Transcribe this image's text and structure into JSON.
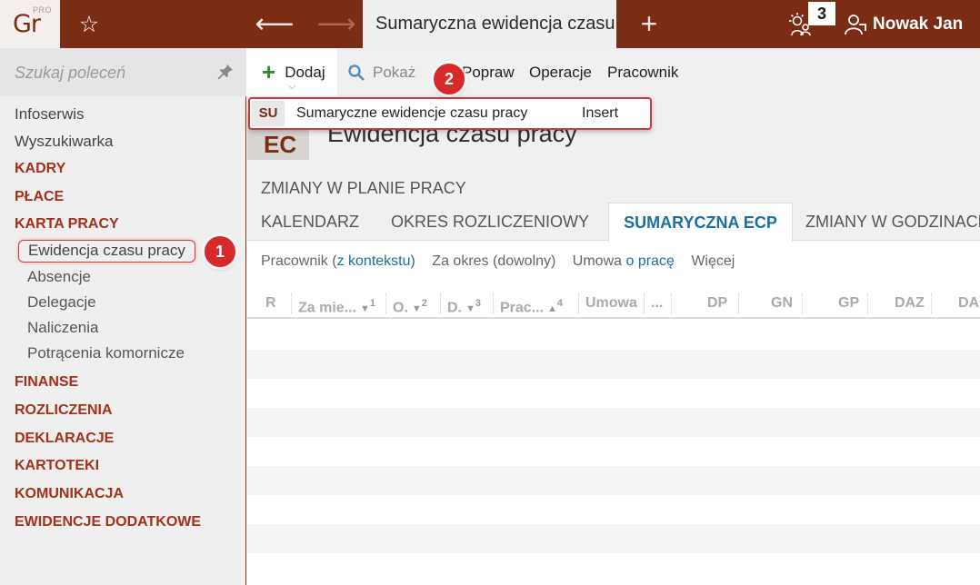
{
  "app": {
    "logo_text": "Gr",
    "logo_badge": "PRO",
    "active_tab": "Sumaryczna ewidencja czasu pracy",
    "notifications_count": "3",
    "user_name": "Nowak Jan"
  },
  "sidebar": {
    "search_placeholder": "Szukaj poleceń",
    "items": [
      {
        "label": "Infoserwis"
      },
      {
        "label": "Wyszukiwarka"
      },
      {
        "label": "KADRY"
      },
      {
        "label": "PŁACE"
      },
      {
        "label": "KARTA PRACY"
      },
      {
        "label": "Ewidencja czasu pracy"
      },
      {
        "label": "Absencje"
      },
      {
        "label": "Delegacje"
      },
      {
        "label": "Naliczenia"
      },
      {
        "label": "Potrącenia komornicze"
      },
      {
        "label": "FINANSE"
      },
      {
        "label": "ROZLICZENIA"
      },
      {
        "label": "DEKLARACJE"
      },
      {
        "label": "KARTOTEKI"
      },
      {
        "label": "KOMUNIKACJA"
      },
      {
        "label": "EWIDENCJE DODATKOWE"
      }
    ]
  },
  "toolbar": {
    "dodaj": "Dodaj",
    "pokaz": "Pokaż",
    "popraw": "Popraw",
    "operacje": "Operacje",
    "pracownik": "Pracownik"
  },
  "dropdown": {
    "code": "SU",
    "label": "Sumaryczne ewidencje czasu pracy",
    "shortcut": "Insert"
  },
  "page": {
    "badge": "EC",
    "title": "Ewidencja czasu pracy",
    "section": "ZMIANY W PLANIE PRACY"
  },
  "tabs": [
    {
      "label": "KALENDARZ"
    },
    {
      "label": "OKRES ROZLICZENIOWY"
    },
    {
      "label": "SUMARYCZNA ECP"
    },
    {
      "label": "ZMIANY W GODZINACH"
    }
  ],
  "filters": {
    "pracownik_prefix": "Pracownik (",
    "pracownik_link": "z kontekstu",
    "pracownik_suffix": ")",
    "okres": "Za okres (dowolny)",
    "umowa_prefix": "Umowa ",
    "umowa_link": "o pracę",
    "wiecej": "Więcej"
  },
  "grid": {
    "columns": [
      {
        "label": "R"
      },
      {
        "label": "Za mie...",
        "sort": "▼",
        "order": "1"
      },
      {
        "label": "O.",
        "sort": "▼",
        "order": "2"
      },
      {
        "label": "D.",
        "sort": "▼",
        "order": "3"
      },
      {
        "label": "Prac...",
        "sort": "▲",
        "order": "4"
      },
      {
        "label": "Umowa"
      },
      {
        "label": "..."
      },
      {
        "label": "DP"
      },
      {
        "label": "GN"
      },
      {
        "label": "GP"
      },
      {
        "label": "DAZ"
      },
      {
        "label": "DA"
      }
    ]
  },
  "markers": {
    "step1": "1",
    "step2": "2"
  },
  "colors": {
    "brand": "#7a2c15",
    "accent_red": "#a2321b",
    "active_tab_text": "#1b6fa3",
    "highlight": "#d23838"
  }
}
